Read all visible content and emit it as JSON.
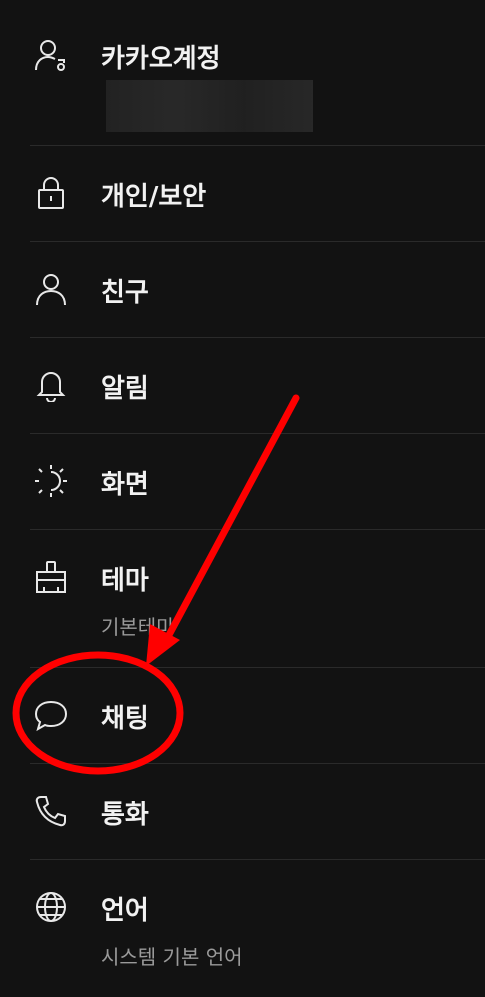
{
  "menu": {
    "items": [
      {
        "key": "kakao-account",
        "label": "카카오계정",
        "icon": "user-account-icon"
      },
      {
        "key": "privacy-security",
        "label": "개인/보안",
        "icon": "lock-icon"
      },
      {
        "key": "friends",
        "label": "친구",
        "icon": "person-icon"
      },
      {
        "key": "notifications",
        "label": "알림",
        "icon": "bell-icon"
      },
      {
        "key": "display",
        "label": "화면",
        "icon": "brightness-icon"
      },
      {
        "key": "theme",
        "label": "테마",
        "sub": "기본테마",
        "icon": "paint-brush-icon"
      },
      {
        "key": "chat",
        "label": "채팅",
        "icon": "chat-bubble-icon"
      },
      {
        "key": "call",
        "label": "통화",
        "icon": "phone-icon"
      },
      {
        "key": "language",
        "label": "언어",
        "sub": "시스템 기본 언어",
        "icon": "globe-icon"
      }
    ]
  },
  "colors": {
    "background": "#121212",
    "text": "#f2f2f2",
    "subtext": "#9a9a9a",
    "divider": "#2a2a2a",
    "annotation": "#ff0000"
  }
}
